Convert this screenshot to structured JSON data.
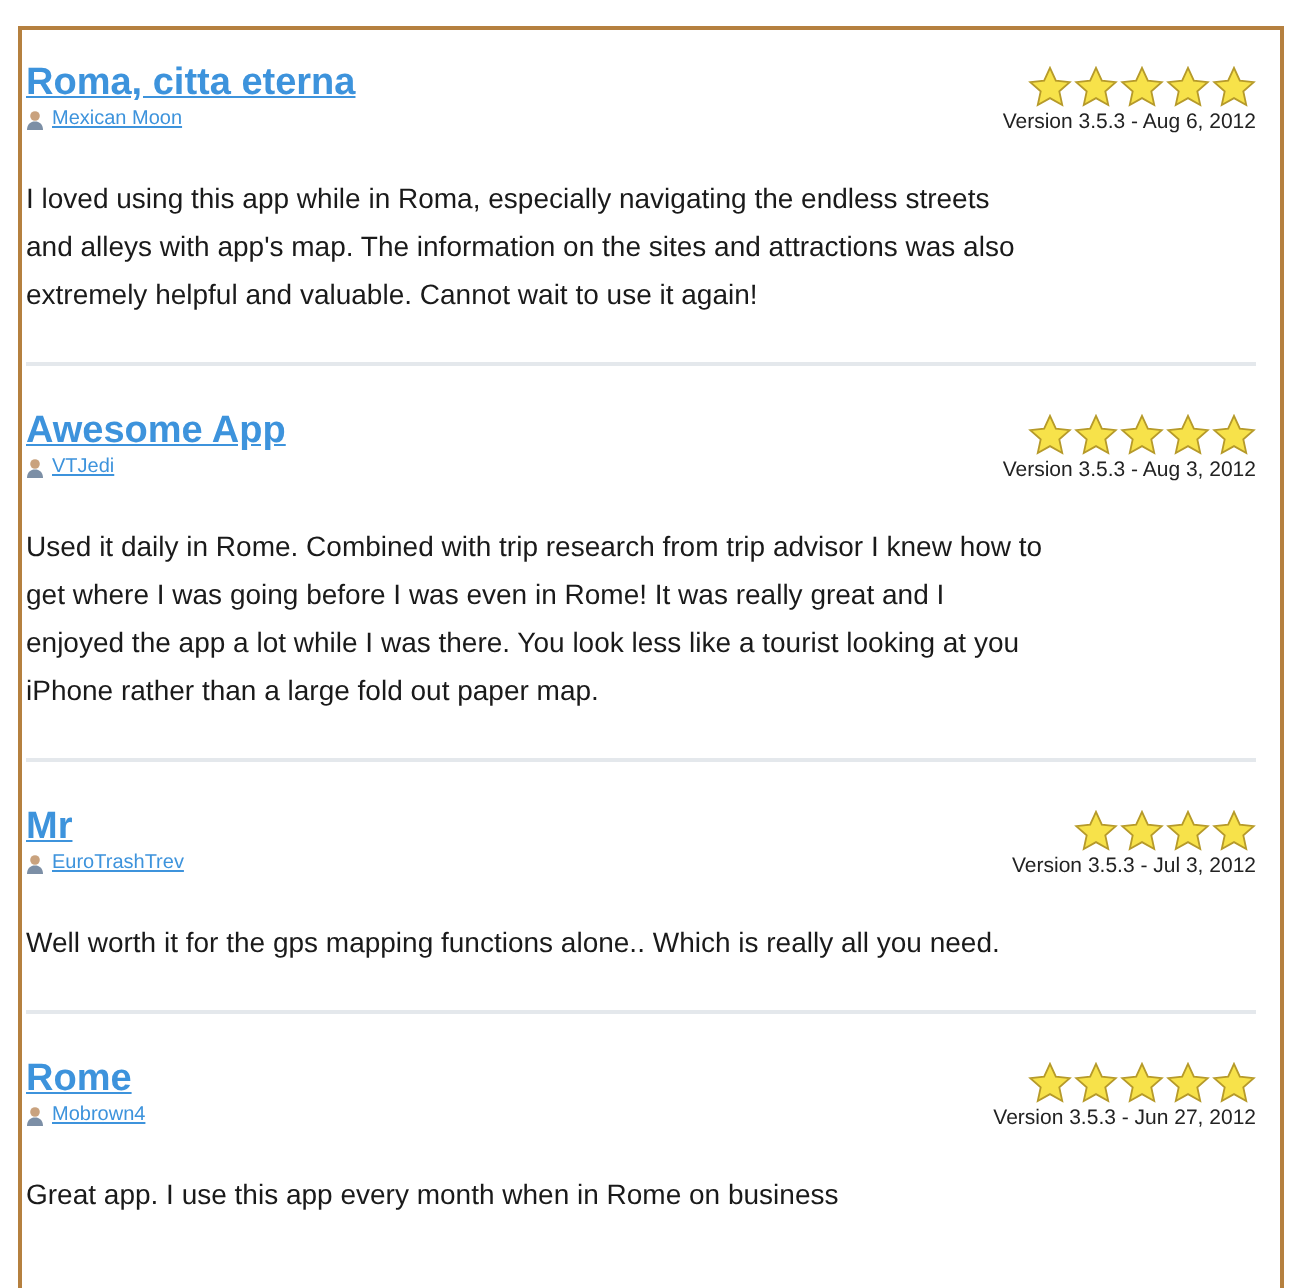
{
  "reviews": [
    {
      "title": "Roma, citta eterna",
      "author": "Mexican Moon",
      "stars": 5,
      "version": "Version 3.5.3 - Aug 6, 2012",
      "lines": [
        "I loved using this app while in Roma, especially navigating the endless streets",
        "and alleys with app's map. The information on the sites and attractions was also",
        "extremely helpful and valuable. Cannot wait to use it again!"
      ]
    },
    {
      "title": "Awesome App",
      "author": "VTJedi",
      "stars": 5,
      "version": "Version 3.5.3 - Aug 3, 2012",
      "lines": [
        "Used it daily in Rome. Combined with trip research from trip advisor I knew how to",
        "get where I was going before I was even in Rome! It was really great and I",
        "enjoyed the app a lot while I was there. You look less like a tourist looking at you",
        "iPhone rather than a large fold out paper map."
      ]
    },
    {
      "title": "Mr",
      "author": "EuroTrashTrev",
      "stars": 4,
      "version": "Version 3.5.3 - Jul 3, 2012",
      "lines": [
        "Well worth it for the gps mapping functions alone.. Which is really all you need."
      ]
    },
    {
      "title": "Rome",
      "author": "Mobrown4",
      "stars": 5,
      "version": "Version 3.5.3 - Jun 27, 2012",
      "lines": [
        "Great app. I use this app every month when in Rome on business"
      ]
    }
  ]
}
